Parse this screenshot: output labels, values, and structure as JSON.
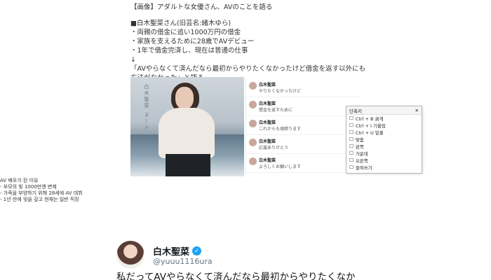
{
  "article": {
    "title": "【画像】アダルトな女優さん、AVのことを語る",
    "lines": [
      "■白木聖菜さん(旧芸名:緒木ゆら)",
      "・両親の借金に追い1000万円の借金",
      "・家族を支えるために28歳でAVデビュー",
      "・1年で借金完済し、現在は普通の仕事"
    ],
    "quote_lines": [
      "「AVやらなくて済んだなら最初からやりたくなかったけど借金を返す以外にも",
      "方法がなかった」と語る"
    ]
  },
  "photo": {
    "vertical_text": "白木聖菜 ヌード"
  },
  "feed": {
    "items": [
      {
        "name": "白木聖菜",
        "text": "やりたくなかったけど"
      },
      {
        "name": "白木聖菜",
        "text": "借金を返すために"
      },
      {
        "name": "白木聖菜",
        "text": "これからも頑張ります"
      },
      {
        "name": "白木聖菜",
        "text": "応援ありがとう"
      },
      {
        "name": "白木聖菜",
        "text": "よろしくお願いします"
      }
    ]
  },
  "dropdown": {
    "header": "단축키",
    "rows": [
      "Ctrl + B  굵게",
      "Ctrl + I  기울임",
      "Ctrl + U  밑줄",
      "맞춤",
      "왼쪽",
      "가운데",
      "오른쪽",
      "들여쓰기"
    ]
  },
  "korean": {
    "lines": [
      "AV 배우가 된 이유",
      "- 부모의 빚 1000만엔 변제",
      "- 가족을 부양하기 위해 28세에 AV 데뷔",
      "- 1년 만에 빚을 갚고 현재는 일반 직장"
    ]
  },
  "tweet": {
    "name": "白木聖菜",
    "handle": "@yuuu1116ura",
    "text": "私だってAVやらなくて済んだなら最初からやりたくなか"
  },
  "colors": {
    "verified": "#1da1f2",
    "link": "#657786"
  }
}
